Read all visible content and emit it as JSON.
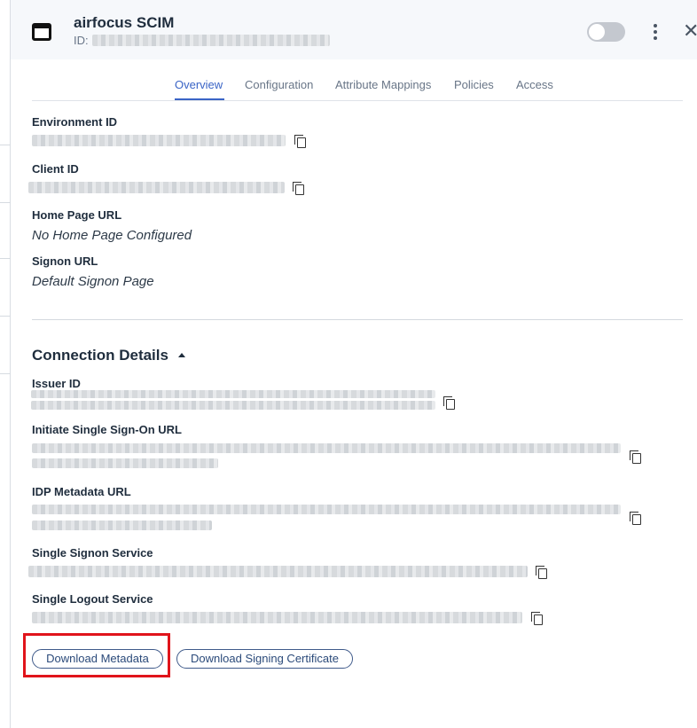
{
  "header": {
    "title": "airfocus SCIM",
    "id_label": "ID:",
    "icon": "app-window-icon"
  },
  "tabs": [
    {
      "label": "Overview",
      "active": true
    },
    {
      "label": "Configuration",
      "active": false
    },
    {
      "label": "Attribute Mappings",
      "active": false
    },
    {
      "label": "Policies",
      "active": false
    },
    {
      "label": "Access",
      "active": false
    }
  ],
  "overview": {
    "environment_id_label": "Environment ID",
    "client_id_label": "Client ID",
    "home_page_url_label": "Home Page URL",
    "home_page_url_value": "No Home Page Configured",
    "signon_url_label": "Signon URL",
    "signon_url_value": "Default Signon Page"
  },
  "connection_details": {
    "title": "Connection Details",
    "issuer_id_label": "Issuer ID",
    "initiate_sso_label": "Initiate Single Sign-On URL",
    "idp_metadata_label": "IDP Metadata URL",
    "single_signon_service_label": "Single Signon Service",
    "single_logout_service_label": "Single Logout Service"
  },
  "actions": {
    "download_metadata": "Download Metadata",
    "download_signing_certificate": "Download Signing Certificate"
  },
  "colors": {
    "accent": "#3a64c6",
    "highlight": "#e0141b"
  }
}
